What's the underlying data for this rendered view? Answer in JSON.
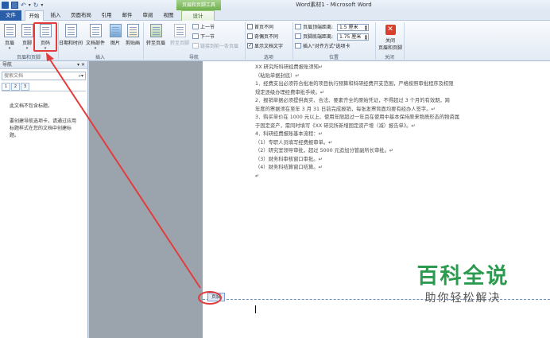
{
  "window": {
    "title": "Word素材1 - Microsoft Word",
    "context_title": "页眉和页脚工具"
  },
  "tabs": [
    {
      "label": "文件"
    },
    {
      "label": "开始"
    },
    {
      "label": "插入"
    },
    {
      "label": "页面布局"
    },
    {
      "label": "引用"
    },
    {
      "label": "邮件"
    },
    {
      "label": "审阅"
    },
    {
      "label": "视图"
    },
    {
      "label": "设计"
    }
  ],
  "ribbon": {
    "header_footer": {
      "group_label": "页眉和页脚",
      "buttons": [
        {
          "label": "页眉"
        },
        {
          "label": "页脚"
        },
        {
          "label": "页码"
        }
      ]
    },
    "insert": {
      "group_label": "插入",
      "buttons": [
        {
          "label": "日期和时间"
        },
        {
          "label": "文档部件"
        },
        {
          "label": "图片"
        },
        {
          "label": "剪贴画"
        }
      ]
    },
    "navigation": {
      "group_label": "导航",
      "goto_header": "转至页眉",
      "goto_footer": "转至页脚",
      "previous": "上一节",
      "next": "下一节",
      "link_previous": "链接到前一条页眉"
    },
    "options": {
      "group_label": "选项",
      "items": [
        {
          "label": "首页不同",
          "checked": false
        },
        {
          "label": "奇偶页不同",
          "checked": false
        },
        {
          "label": "显示文档文字",
          "checked": true
        }
      ]
    },
    "position": {
      "group_label": "位置",
      "header_from_top_label": "页眉顶端距离:",
      "header_from_top_value": "1.5 厘米",
      "footer_from_bottom_label": "页脚底端距离:",
      "footer_from_bottom_value": "1.75 厘米",
      "insert_align_tab": "插入\"对齐方式\"选项卡"
    },
    "close": {
      "group_label": "关闭",
      "button_line1": "关闭",
      "button_line2": "页眉和页脚"
    }
  },
  "nav_pane": {
    "title": "导航",
    "search_placeholder": "搜索文档",
    "tabs": [
      "1",
      "2",
      "3"
    ],
    "message_1": "此文档不包含标题。",
    "message_2": "要创建导航选项卡，请通过应用标题样式在您的文档中创建标题。"
  },
  "document": {
    "lines": [
      "XX 研究所科研经费报账须知↵",
      "（粘贴单据封底）↵",
      "1．经费支出必须符合批准的项目执行预算和科研经费开支范围，严格按照审批程序及权限",
      "规定逐级办理经费审批手续。↵",
      "2．报销单据必须提供真实、合法、要素齐全的原始凭证，不得超过 3 个月的有效期，跨",
      "年度的票据须在至年 3 月 31 日前完成报销，每张发票背面均要有经办人签字。↵",
      "3．购买单价在 1000 元以上、使用年限超过一年且在使用中基本保持原来物质形态的物资属",
      "于固定资产，需同时填写《XX 研究所新增固定资产增（减）报告单》。↵",
      "4．科研经费报账基本流程：↵",
      "（1）专职人员填写经费报审单。↵",
      "（2）研究室领导审批，超过 5000 元追加分管副所长审批。↵",
      "（3）财务科审核窗口审批。↵",
      "（4）财务科结算窗口结算。↵",
      "↵"
    ],
    "footer_tag": "页脚"
  },
  "watermark": {
    "title": "百科全说",
    "subtitle": "助你轻松解决"
  },
  "colors": {
    "accent": "#2a5ea8",
    "context_green": "#6fb04d",
    "highlight_red": "#e23c3c",
    "watermark_green": "#2c9b4f"
  }
}
